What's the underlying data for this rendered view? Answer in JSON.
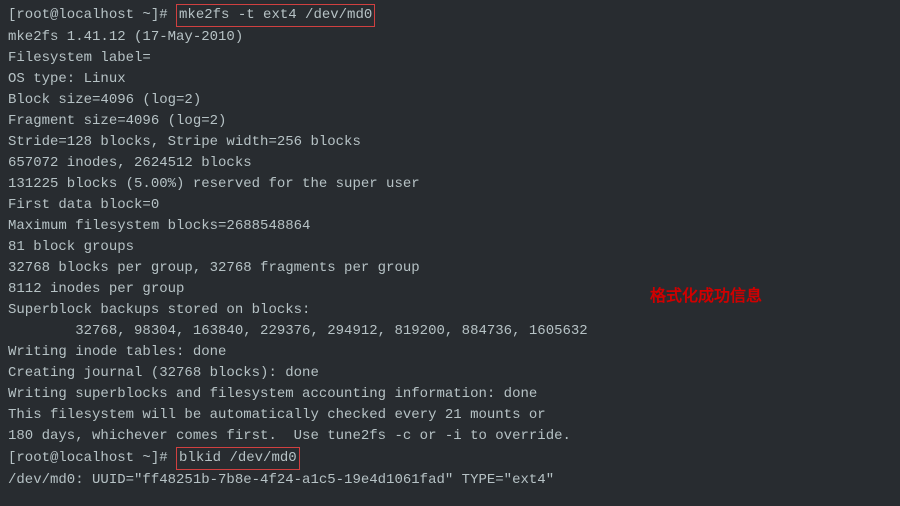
{
  "prompt1": {
    "prefix": "[root@localhost ~]# ",
    "command": "mke2fs -t ext4 /dev/md0"
  },
  "output": {
    "line1": "mke2fs 1.41.12 (17-May-2010)",
    "line2": "Filesystem label=",
    "line3": "OS type: Linux",
    "line4": "Block size=4096 (log=2)",
    "line5": "Fragment size=4096 (log=2)",
    "line6": "Stride=128 blocks, Stripe width=256 blocks",
    "line7": "657072 inodes, 2624512 blocks",
    "line8": "131225 blocks (5.00%) reserved for the super user",
    "line9": "First data block=0",
    "line10": "Maximum filesystem blocks=2688548864",
    "line11": "81 block groups",
    "line12": "32768 blocks per group, 32768 fragments per group",
    "line13": "8112 inodes per group",
    "line14": "Superblock backups stored on blocks: ",
    "line15": "        32768, 98304, 163840, 229376, 294912, 819200, 884736, 1605632",
    "line16": "",
    "line17": "Writing inode tables: done                            ",
    "line18": "Creating journal (32768 blocks): done",
    "line19": "Writing superblocks and filesystem accounting information: done",
    "line20": "",
    "line21": "This filesystem will be automatically checked every 21 mounts or",
    "line22": "180 days, whichever comes first.  Use tune2fs -c or -i to override."
  },
  "prompt2": {
    "prefix": "[root@localhost ~]# ",
    "command": "blkid /dev/md0"
  },
  "output2": {
    "line1": "/dev/md0: UUID=\"ff48251b-7b8e-4f24-a1c5-19e4d1061fad\" TYPE=\"ext4\" "
  },
  "annotation1": "格式化成功信息"
}
